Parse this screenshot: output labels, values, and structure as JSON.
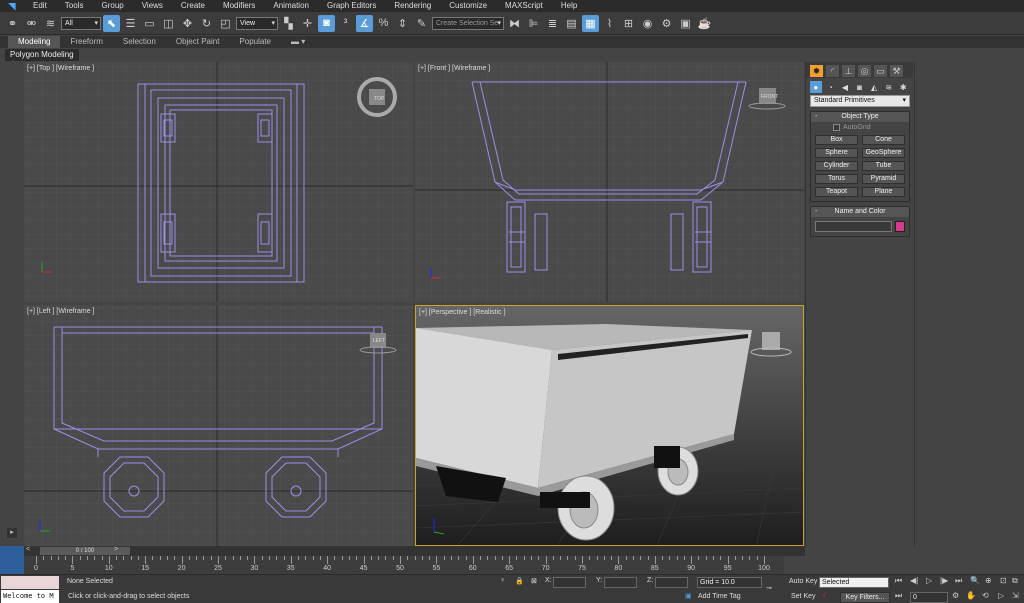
{
  "menu": {
    "items": [
      "Edit",
      "Tools",
      "Group",
      "Views",
      "Create",
      "Modifiers",
      "Animation",
      "Graph Editors",
      "Rendering",
      "Customize",
      "MAXScript",
      "Help"
    ]
  },
  "toolbar": {
    "filter_value": "All",
    "refcoord_value": "View",
    "selection_set_placeholder": "Create Selection Se"
  },
  "ribbon": {
    "tabs": [
      "Modeling",
      "Freeform",
      "Selection",
      "Object Paint",
      "Populate"
    ],
    "active_tab": "Modeling",
    "panel_label": "Polygon Modeling"
  },
  "viewports": {
    "top": "[+] [Top ] [Wireframe ]",
    "front": "[+] [Front ] [Wireframe ]",
    "left": "[+] [Left ] [Wireframe ]",
    "perspective": "[+] [Perspective ] [Realistic ]",
    "viewcube_top": "TOP",
    "viewcube_front": "FRONT",
    "viewcube_left": "LEFT"
  },
  "command_panel": {
    "category_value": "Standard Primitives",
    "object_type_title": "Object Type",
    "autogrid_label": "AutoGrid",
    "primitives": [
      "Box",
      "Cone",
      "Sphere",
      "GeoSphere",
      "Cylinder",
      "Tube",
      "Torus",
      "Pyramid",
      "Teapot",
      "Plane"
    ],
    "name_color_title": "Name and Color",
    "swatch_color": "#d63a8a"
  },
  "timeline": {
    "slider_label": "0 / 100",
    "ticks": [
      0,
      5,
      10,
      15,
      20,
      25,
      30,
      35,
      40,
      45,
      50,
      55,
      60,
      65,
      70,
      75,
      80,
      85,
      90,
      95,
      100
    ]
  },
  "status": {
    "maxscript_label": "Welcome to M",
    "selection_text": "None Selected",
    "prompt_text": "Click or click-and-drag to select objects",
    "x_label": "X:",
    "y_label": "Y:",
    "z_label": "Z:",
    "grid_text": "Grid = 10.0",
    "add_time_tag": "Add Time Tag",
    "auto_key": "Auto Key",
    "set_key": "Set Key",
    "selected_value": "Selected",
    "key_filters": "Key Filters...",
    "frame_value": "0"
  },
  "colors": {
    "accent": "#5a9cd8",
    "wireframe": "#9b8fe6",
    "active_viewport": "#c9a227"
  }
}
